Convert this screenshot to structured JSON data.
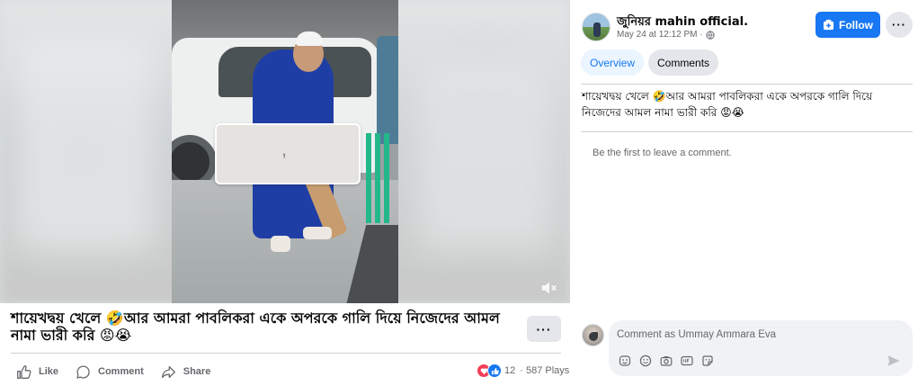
{
  "post": {
    "caption": "শায়েখদ্বয় খেলে 🤣আর আমরা পাবলিকরা একে অপরকে গালি দিয়ে নিজেদের আমল নামা ভারী করি 😡😭",
    "more_label": "···",
    "actions": {
      "like": "Like",
      "comment": "Comment",
      "share": "Share"
    },
    "reaction_count": "12",
    "plays": "· 587 Plays"
  },
  "video": {
    "blur_card_text": ","
  },
  "panel": {
    "author": "জুনিয়র mahin official.",
    "date": "May 24 at 12:12 PM ·",
    "follow_label": "Follow",
    "more_label": "···",
    "tabs": [
      {
        "label": "Overview",
        "active": true
      },
      {
        "label": "Comments",
        "active": false
      }
    ],
    "post_text": "শায়েখদ্বয় খেলে 🤣আর আমরা পাবলিকরা একে অপরকে গালি দিয়ে নিজেদের আমল নামা ভারী করি 😡😭",
    "no_comments": "Be the first to leave a comment.",
    "comment_placeholder": "Comment as Ummay Ammara Eva",
    "comment_tools": [
      "avatar-sticker-icon",
      "emoji-icon",
      "camera-icon",
      "gif-icon",
      "sticker-icon"
    ]
  },
  "colors": {
    "accent": "#1877f2",
    "secondary_text": "#65676b",
    "button_gray": "#e4e6eb",
    "heart": "#f33e58"
  }
}
